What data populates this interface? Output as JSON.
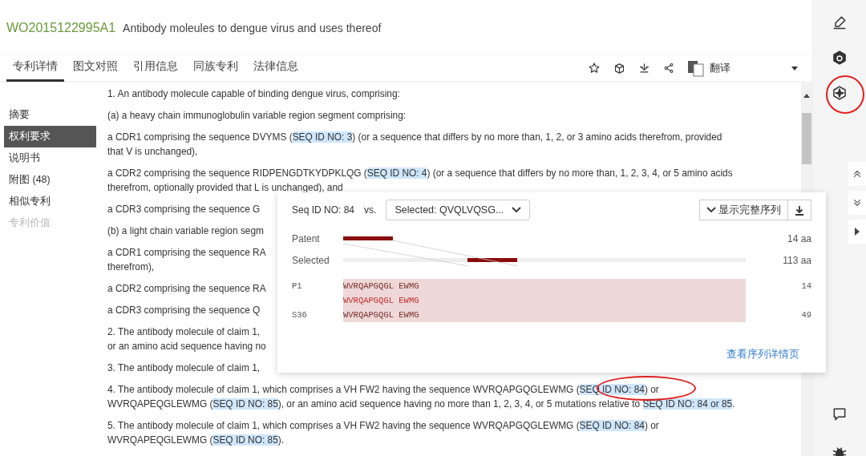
{
  "header": {
    "patent_number": "WO2015122995A1",
    "title": "Antibody moleules to dengue virus and uses thereof"
  },
  "tabs": [
    {
      "label": "专利详情",
      "selected": true
    },
    {
      "label": "图文对照",
      "selected": false
    },
    {
      "label": "引用信息",
      "selected": false
    },
    {
      "label": "同族专利",
      "selected": false
    },
    {
      "label": "法律信息",
      "selected": false
    }
  ],
  "toolbar": {
    "translate_label": "翻译"
  },
  "sidebar": {
    "items": [
      {
        "label": "摘要",
        "selected": false,
        "disabled": false
      },
      {
        "label": "权利要求",
        "selected": true,
        "disabled": false
      },
      {
        "label": "说明书",
        "selected": false,
        "disabled": false
      },
      {
        "label": "附图 (48)",
        "selected": false,
        "disabled": false
      },
      {
        "label": "相似专利",
        "selected": false,
        "disabled": false
      },
      {
        "label": "专利价值",
        "selected": false,
        "disabled": true
      }
    ]
  },
  "claims": [
    {
      "lines": [
        [
          {
            "text": "1. An antibody molecule capable of binding dengue virus, comprising:",
            "highlight": false
          }
        ]
      ]
    },
    {
      "lines": [
        [
          {
            "text": "(a) a heavy chain immunoglobulin variable region segment comprising:",
            "highlight": false
          }
        ]
      ]
    },
    {
      "lines": [
        [
          {
            "text": "a CDR1 comprising the sequence DVYMS (",
            "highlight": false
          },
          {
            "text": "SEQ ID NO: 3",
            "highlight": true
          },
          {
            "text": ") (or a sequence that differs by no more than, 1, 2, or 3 amino acids therefrom, provided",
            "highlight": false
          }
        ],
        [
          {
            "text": "that V is unchanged),",
            "highlight": false
          }
        ]
      ]
    },
    {
      "lines": [
        [
          {
            "text": "a CDR2 comprising the sequence RIDPENGDTKYDPKLQG (",
            "highlight": false
          },
          {
            "text": "SEQ ID NO: 4",
            "highlight": true
          },
          {
            "text": ") (or a sequence that differs by no more than, 1, 2, 3, 4, or 5 amino acids",
            "highlight": false
          }
        ],
        [
          {
            "text": "therefrom, optionally provided that L is unchanged), and",
            "highlight": false
          }
        ]
      ]
    },
    {
      "lines": [
        [
          {
            "text": "a CDR3 comprising the sequence G",
            "highlight": false
          }
        ]
      ]
    },
    {
      "lines": [
        [
          {
            "text": "(b) a light chain variable region segm",
            "highlight": false
          }
        ]
      ]
    },
    {
      "lines": [
        [
          {
            "text": "a CDR1 comprising the sequence RA",
            "highlight": false
          }
        ],
        [
          {
            "text": "therefrom),",
            "highlight": false
          }
        ]
      ]
    },
    {
      "lines": [
        [
          {
            "text": "a CDR2 comprising the sequence RA",
            "highlight": false
          }
        ]
      ]
    },
    {
      "lines": [
        [
          {
            "text": "a CDR3 comprising the sequence Q",
            "highlight": false
          }
        ]
      ]
    },
    {
      "lines": [
        [
          {
            "text": "2. The antibody molecule of claim 1,",
            "highlight": false
          }
        ],
        [
          {
            "text": "or an amino acid sequence having no",
            "highlight": false
          }
        ]
      ]
    },
    {
      "lines": [
        [
          {
            "text": "3. The antibody molecule of claim 1,",
            "highlight": false
          }
        ]
      ]
    },
    {
      "lines": [
        [
          {
            "text": "4. The antibody molecule of claim 1, which comprises a VH FW2 having the sequence WVRQAPGQGLEWMG (",
            "highlight": false
          },
          {
            "text": "SEQ ID NO: 84",
            "highlight": true
          },
          {
            "text": ") or",
            "highlight": false
          }
        ],
        [
          {
            "text": "WVRQAPEQGLEWMG (",
            "highlight": false
          },
          {
            "text": "SEQ ID NO: 85",
            "highlight": true
          },
          {
            "text": "), or an amino acid sequence having no more than 1, 2, 3, 4, or 5 mutations relative to ",
            "highlight": false
          },
          {
            "text": "SEQ ID NO: 84 or 85",
            "highlight": true
          },
          {
            "text": ".",
            "highlight": false
          }
        ]
      ]
    },
    {
      "lines": [
        [
          {
            "text": "5. The antibody molecule of claim 1, which comprises a VH FW2 having the sequence WVRQAPGQGLEWMG (",
            "highlight": false
          },
          {
            "text": "SEQ ID NO: 84",
            "highlight": true
          },
          {
            "text": ") or",
            "highlight": false
          }
        ],
        [
          {
            "text": "WVRQAPEQGLEWMG (",
            "highlight": false
          },
          {
            "text": "SEQ ID NO: 85",
            "highlight": true
          },
          {
            "text": ").",
            "highlight": false
          }
        ]
      ]
    }
  ],
  "popup": {
    "seq_label": "Seq ID NO: 84",
    "vs": "vs.",
    "selected_dropdown": "Selected: QVQLVQSG...",
    "show_full_button": "显示完整序列",
    "tracks": [
      {
        "label": "Patent",
        "length": "14 aa",
        "kind": "patent"
      },
      {
        "label": "Selected",
        "length": "113 aa",
        "kind": "selected"
      }
    ],
    "alignment": [
      {
        "label": "P1",
        "sequence": "WVRQAPGQGL EWMG",
        "end": "14",
        "kind": "query"
      },
      {
        "sequence": "WVRQAPGQGL EWMG",
        "kind": "match"
      },
      {
        "label": "S36",
        "sequence": "WVRQAPGQGL EWMG",
        "end": "49",
        "kind": "subject"
      }
    ],
    "detail_link": "查看序列详情页"
  }
}
